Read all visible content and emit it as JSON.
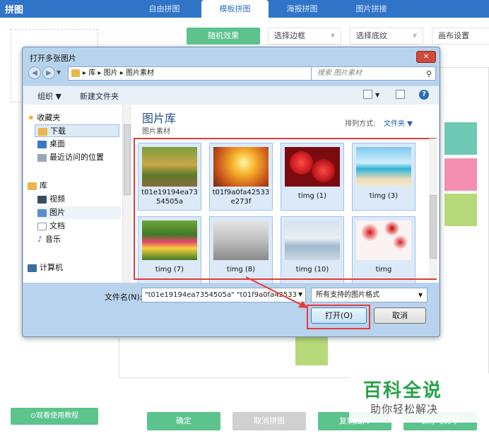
{
  "app": {
    "title": "拼图",
    "tabs": [
      {
        "label": "自由拼图",
        "active": false
      },
      {
        "label": "模板拼图",
        "active": true
      },
      {
        "label": "海报拼图",
        "active": false
      },
      {
        "label": "图片拼接",
        "active": false
      }
    ]
  },
  "toolbar": {
    "random_label": "随机效果",
    "border_label": "选择边框",
    "texture_label": "选择底纹",
    "canvas_label": "画布设置"
  },
  "bottom": {
    "tutorial_label": "⊙观看使用教程",
    "confirm_label": "确定",
    "cancel_collage_label": "取消拼图",
    "copy_label": "复制图片",
    "save_label": "保存与分享"
  },
  "watermark": {
    "line1": "百科全说",
    "line2": "助你轻松解决"
  },
  "colors": {
    "accent": "#2f74c7",
    "green": "#5cc38d",
    "red_highlight": "#e53b3b",
    "teal": "#6fcab5",
    "pink": "#f48fb1",
    "lime": "#b6d97a"
  },
  "dialog": {
    "title": "打开多张图片",
    "close_symbol": "✕",
    "breadcrumb": [
      "库",
      "图片",
      "图片素材"
    ],
    "search_placeholder": "搜索 图片素材",
    "organize_label": "组织 ▼",
    "new_folder_label": "新建文件夹",
    "nav": [
      {
        "label": "收藏夹",
        "icon": "star-icon",
        "level": 0
      },
      {
        "label": "下载",
        "icon": "download-folder-icon",
        "level": 1,
        "selected": true
      },
      {
        "label": "桌面",
        "icon": "desktop-icon",
        "level": 1
      },
      {
        "label": "最近访问的位置",
        "icon": "recent-places-icon",
        "level": 1
      },
      {
        "label": "库",
        "icon": "library-icon",
        "level": 0
      },
      {
        "label": "视频",
        "icon": "video-icon",
        "level": 1
      },
      {
        "label": "图片",
        "icon": "pictures-icon",
        "level": 1,
        "highlighted": true
      },
      {
        "label": "文档",
        "icon": "documents-icon",
        "level": 1
      },
      {
        "label": "音乐",
        "icon": "music-icon",
        "level": 1
      },
      {
        "label": "计算机",
        "icon": "computer-icon",
        "level": 0
      }
    ],
    "library_title": "图片库",
    "library_sub": "图片素材",
    "sort_label": "排列方式:",
    "sort_value": "文件夹 ▼",
    "files": [
      {
        "name": "t01e19194ea7354505a",
        "line1": "t01e19194ea73",
        "line2": "54505a",
        "thumb": "forest-road"
      },
      {
        "name": "t01f9a0fa42533e273f",
        "line1": "t01f9a0fa42533",
        "line2": "e273f",
        "thumb": "sunset-tree"
      },
      {
        "name": "timg (1)",
        "line1": "timg (1)",
        "line2": "",
        "thumb": "roses"
      },
      {
        "name": "timg (3)",
        "line1": "timg (3)",
        "line2": "",
        "thumb": "beach"
      },
      {
        "name": "timg (7)",
        "line1": "timg (7)",
        "line2": "",
        "thumb": "tulips"
      },
      {
        "name": "timg (8)",
        "line1": "timg (8)",
        "line2": "",
        "thumb": "couple-bw"
      },
      {
        "name": "timg (10)",
        "line1": "timg (10)",
        "line2": "",
        "thumb": "sea-girl"
      },
      {
        "name": "timg",
        "line1": "timg",
        "line2": "",
        "thumb": "red-petals"
      }
    ],
    "filename_label": "文件名(N):",
    "filename_value": "\"t01e19194ea7354505a\" \"t01f9a0fa42533",
    "filetype_value": "所有支持的图片格式",
    "open_label": "打开(O)",
    "cancel_label": "取消"
  }
}
